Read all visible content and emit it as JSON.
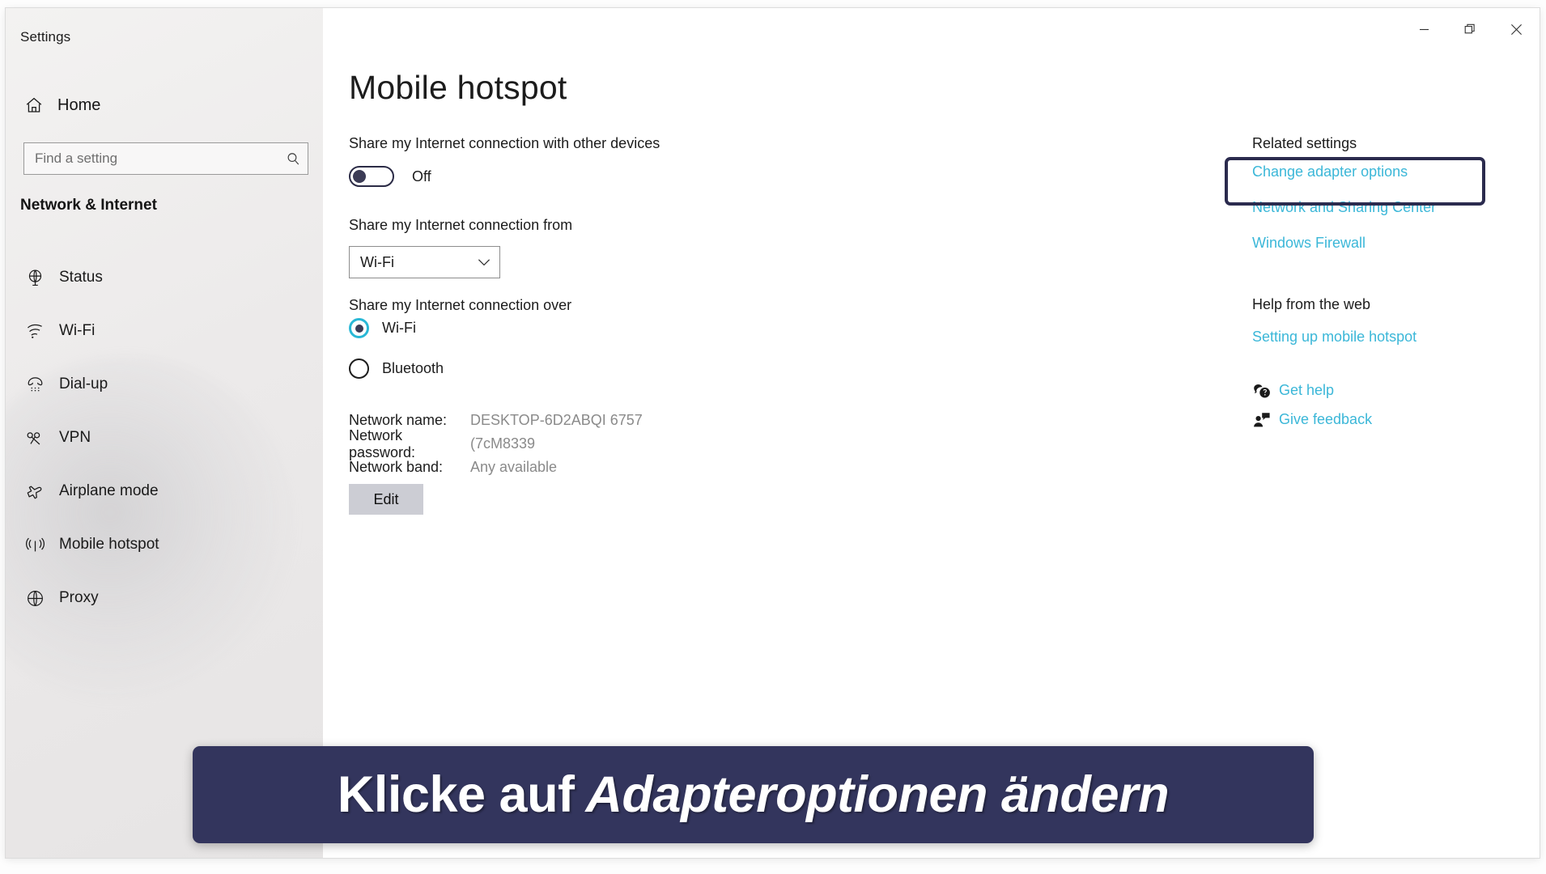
{
  "window": {
    "title": "Settings",
    "controls": {
      "minimize": "minimize-icon",
      "restore": "restore-icon",
      "close": "close-icon"
    }
  },
  "sidebar": {
    "home_label": "Home",
    "home_icon": "home-icon",
    "search": {
      "placeholder": "Find a setting",
      "value": "",
      "icon": "search-icon"
    },
    "section_title": "Network & Internet",
    "items": [
      {
        "label": "Status",
        "icon": "globe-status-icon"
      },
      {
        "label": "Wi-Fi",
        "icon": "wifi-icon"
      },
      {
        "label": "Dial-up",
        "icon": "dialup-phone-icon"
      },
      {
        "label": "VPN",
        "icon": "vpn-key-icon"
      },
      {
        "label": "Airplane mode",
        "icon": "airplane-icon"
      },
      {
        "label": "Mobile hotspot",
        "icon": "hotspot-antenna-icon"
      },
      {
        "label": "Proxy",
        "icon": "globe-icon"
      }
    ]
  },
  "main": {
    "page_title": "Mobile hotspot",
    "share_toggle": {
      "label": "Share my Internet connection with other devices",
      "state": "Off"
    },
    "share_from": {
      "label": "Share my Internet connection from",
      "selected": "Wi-Fi",
      "chevron_icon": "chevron-down-icon"
    },
    "share_over": {
      "label": "Share my Internet connection over",
      "options": [
        {
          "label": "Wi-Fi",
          "selected": true
        },
        {
          "label": "Bluetooth",
          "selected": false
        }
      ]
    },
    "details": [
      {
        "key": "Network name:",
        "value": "DESKTOP-6D2ABQI 6757"
      },
      {
        "key": "Network password:",
        "value": "(7cM8339"
      },
      {
        "key": "Network band:",
        "value": "Any available"
      }
    ],
    "edit_button": "Edit"
  },
  "rail": {
    "related_heading": "Related settings",
    "related_links": [
      "Change adapter options",
      "Network and Sharing Center",
      "Windows Firewall"
    ],
    "help_heading": "Help from the web",
    "help_links": [
      "Setting up mobile hotspot"
    ],
    "action_links": [
      {
        "label": "Get help",
        "icon": "help-bubble-icon"
      },
      {
        "label": "Give feedback",
        "icon": "feedback-person-icon"
      }
    ]
  },
  "highlight": {
    "target": "Change adapter options",
    "border_color": "#2b2b4e"
  },
  "caption": {
    "prefix": "Klicke auf",
    "emphasis": "Adapteroptionen ändern",
    "background_color": "#33355d",
    "text_color": "#ffffff"
  },
  "colors": {
    "accent_link": "#3bb7d8",
    "radio_selected": "#2ab8d6",
    "toggle_border": "#2b2b46",
    "edit_button_bg": "#cccdd4",
    "muted_text": "#8a8a8a"
  }
}
